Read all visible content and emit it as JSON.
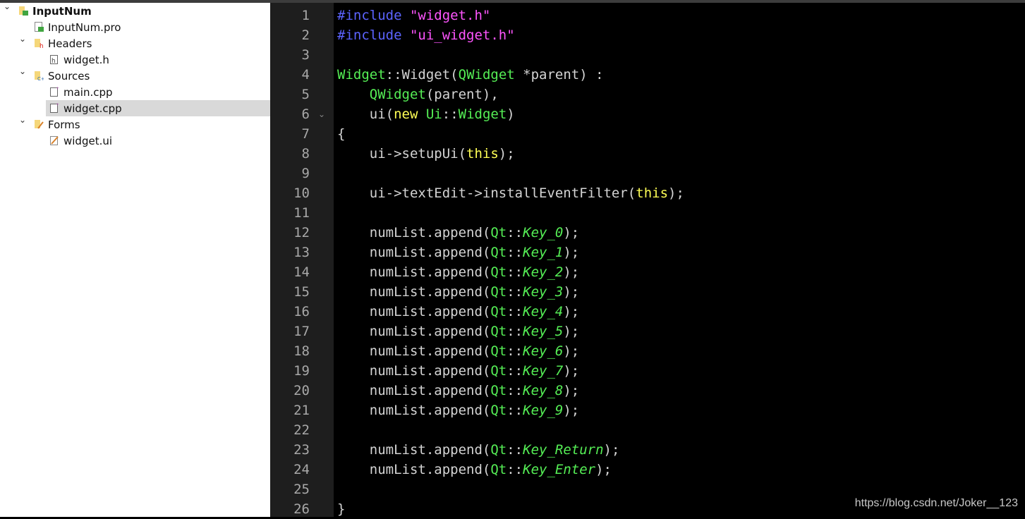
{
  "project_tree": [
    {
      "label": "InputNum",
      "depth": 0,
      "expanded": true,
      "icon": "qt-project-folder-icon",
      "bold": true
    },
    {
      "label": "InputNum.pro",
      "depth": 1,
      "icon": "qt-pro-file-icon"
    },
    {
      "label": "Headers",
      "depth": 1,
      "expanded": true,
      "icon": "headers-folder-icon"
    },
    {
      "label": "widget.h",
      "depth": 2,
      "icon": "header-file-icon"
    },
    {
      "label": "Sources",
      "depth": 1,
      "expanded": true,
      "icon": "sources-folder-icon"
    },
    {
      "label": "main.cpp",
      "depth": 2,
      "icon": "cpp-file-icon"
    },
    {
      "label": "widget.cpp",
      "depth": 2,
      "icon": "cpp-file-icon",
      "selected": true
    },
    {
      "label": "Forms",
      "depth": 1,
      "expanded": true,
      "icon": "forms-folder-icon"
    },
    {
      "label": "widget.ui",
      "depth": 2,
      "icon": "ui-file-icon"
    }
  ],
  "colors": {
    "preprocessor": "#5c64ff",
    "string": "#ff55ff",
    "type": "#55ee55",
    "keyword": "#ffff55",
    "text": "#d4d4d4",
    "background": "#000000"
  },
  "editor": {
    "fold_line": 6,
    "lines": [
      {
        "n": "1",
        "tokens": [
          [
            "#include ",
            "pp"
          ],
          [
            "\"widget.h\"",
            "str"
          ]
        ]
      },
      {
        "n": "2",
        "tokens": [
          [
            "#include ",
            "pp"
          ],
          [
            "\"ui_widget.h\"",
            "str"
          ]
        ]
      },
      {
        "n": "3",
        "tokens": []
      },
      {
        "n": "4",
        "tokens": [
          [
            "Widget",
            "type"
          ],
          [
            "::",
            "txt"
          ],
          [
            "Widget",
            "txt"
          ],
          [
            "(",
            "txt"
          ],
          [
            "QWidget",
            "type"
          ],
          [
            " *parent) :",
            "txt"
          ]
        ]
      },
      {
        "n": "5",
        "tokens": [
          [
            "    ",
            "txt"
          ],
          [
            "QWidget",
            "type"
          ],
          [
            "(parent),",
            "txt"
          ]
        ]
      },
      {
        "n": "6",
        "tokens": [
          [
            "    ui(",
            "txt"
          ],
          [
            "new",
            "kw"
          ],
          [
            " ",
            "txt"
          ],
          [
            "Ui",
            "type"
          ],
          [
            "::",
            "txt"
          ],
          [
            "Widget",
            "type"
          ],
          [
            ")",
            "txt"
          ]
        ]
      },
      {
        "n": "7",
        "tokens": [
          [
            "{",
            "txt"
          ]
        ]
      },
      {
        "n": "8",
        "tokens": [
          [
            "    ui->setupUi(",
            "txt"
          ],
          [
            "this",
            "kw"
          ],
          [
            ");",
            "txt"
          ]
        ]
      },
      {
        "n": "9",
        "tokens": []
      },
      {
        "n": "10",
        "tokens": [
          [
            "    ui->textEdit->installEventFilter(",
            "txt"
          ],
          [
            "this",
            "kw"
          ],
          [
            ");",
            "txt"
          ]
        ]
      },
      {
        "n": "11",
        "tokens": []
      },
      {
        "n": "12",
        "tokens": [
          [
            "    numList.append(",
            "txt"
          ],
          [
            "Qt",
            "type"
          ],
          [
            "::",
            "txt"
          ],
          [
            "Key_0",
            "enum"
          ],
          [
            ");",
            "txt"
          ]
        ]
      },
      {
        "n": "13",
        "tokens": [
          [
            "    numList.append(",
            "txt"
          ],
          [
            "Qt",
            "type"
          ],
          [
            "::",
            "txt"
          ],
          [
            "Key_1",
            "enum"
          ],
          [
            ");",
            "txt"
          ]
        ]
      },
      {
        "n": "14",
        "tokens": [
          [
            "    numList.append(",
            "txt"
          ],
          [
            "Qt",
            "type"
          ],
          [
            "::",
            "txt"
          ],
          [
            "Key_2",
            "enum"
          ],
          [
            ");",
            "txt"
          ]
        ]
      },
      {
        "n": "15",
        "tokens": [
          [
            "    numList.append(",
            "txt"
          ],
          [
            "Qt",
            "type"
          ],
          [
            "::",
            "txt"
          ],
          [
            "Key_3",
            "enum"
          ],
          [
            ");",
            "txt"
          ]
        ]
      },
      {
        "n": "16",
        "tokens": [
          [
            "    numList.append(",
            "txt"
          ],
          [
            "Qt",
            "type"
          ],
          [
            "::",
            "txt"
          ],
          [
            "Key_4",
            "enum"
          ],
          [
            ");",
            "txt"
          ]
        ]
      },
      {
        "n": "17",
        "tokens": [
          [
            "    numList.append(",
            "txt"
          ],
          [
            "Qt",
            "type"
          ],
          [
            "::",
            "txt"
          ],
          [
            "Key_5",
            "enum"
          ],
          [
            ");",
            "txt"
          ]
        ]
      },
      {
        "n": "18",
        "tokens": [
          [
            "    numList.append(",
            "txt"
          ],
          [
            "Qt",
            "type"
          ],
          [
            "::",
            "txt"
          ],
          [
            "Key_6",
            "enum"
          ],
          [
            ");",
            "txt"
          ]
        ]
      },
      {
        "n": "19",
        "tokens": [
          [
            "    numList.append(",
            "txt"
          ],
          [
            "Qt",
            "type"
          ],
          [
            "::",
            "txt"
          ],
          [
            "Key_7",
            "enum"
          ],
          [
            ");",
            "txt"
          ]
        ]
      },
      {
        "n": "20",
        "tokens": [
          [
            "    numList.append(",
            "txt"
          ],
          [
            "Qt",
            "type"
          ],
          [
            "::",
            "txt"
          ],
          [
            "Key_8",
            "enum"
          ],
          [
            ");",
            "txt"
          ]
        ]
      },
      {
        "n": "21",
        "tokens": [
          [
            "    numList.append(",
            "txt"
          ],
          [
            "Qt",
            "type"
          ],
          [
            "::",
            "txt"
          ],
          [
            "Key_9",
            "enum"
          ],
          [
            ");",
            "txt"
          ]
        ]
      },
      {
        "n": "22",
        "tokens": []
      },
      {
        "n": "23",
        "tokens": [
          [
            "    numList.append(",
            "txt"
          ],
          [
            "Qt",
            "type"
          ],
          [
            "::",
            "txt"
          ],
          [
            "Key_Return",
            "enum"
          ],
          [
            ");",
            "txt"
          ]
        ]
      },
      {
        "n": "24",
        "tokens": [
          [
            "    numList.append(",
            "txt"
          ],
          [
            "Qt",
            "type"
          ],
          [
            "::",
            "txt"
          ],
          [
            "Key_Enter",
            "enum"
          ],
          [
            ");",
            "txt"
          ]
        ]
      },
      {
        "n": "25",
        "tokens": []
      },
      {
        "n": "26",
        "tokens": [
          [
            "}",
            "txt"
          ]
        ]
      }
    ]
  },
  "watermark": "https://blog.csdn.net/Joker__123"
}
